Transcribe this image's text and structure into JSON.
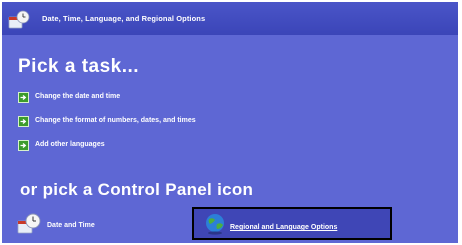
{
  "window": {
    "title": "Date, Time, Language, and Regional Options"
  },
  "main": {
    "pick_task_heading": "Pick a task...",
    "tasks": [
      {
        "label": "Change the date and time",
        "icon": "green-arrow-icon"
      },
      {
        "label": "Change the format of numbers, dates, and times",
        "icon": "green-arrow-icon"
      },
      {
        "label": "Add other languages",
        "icon": "green-arrow-icon"
      }
    ],
    "control_panel_heading": "or pick a Control Panel icon",
    "control_panel_icons": [
      {
        "label": "Date and Time",
        "icon": "clock-icon"
      },
      {
        "label": "Regional and Language Options",
        "icon": "globe-icon",
        "selected": true
      }
    ]
  },
  "colors": {
    "background": "#5e67d4",
    "titlebar": "#3b45b8",
    "task_arrow": "#3c9b2c",
    "text": "#ffffff"
  }
}
